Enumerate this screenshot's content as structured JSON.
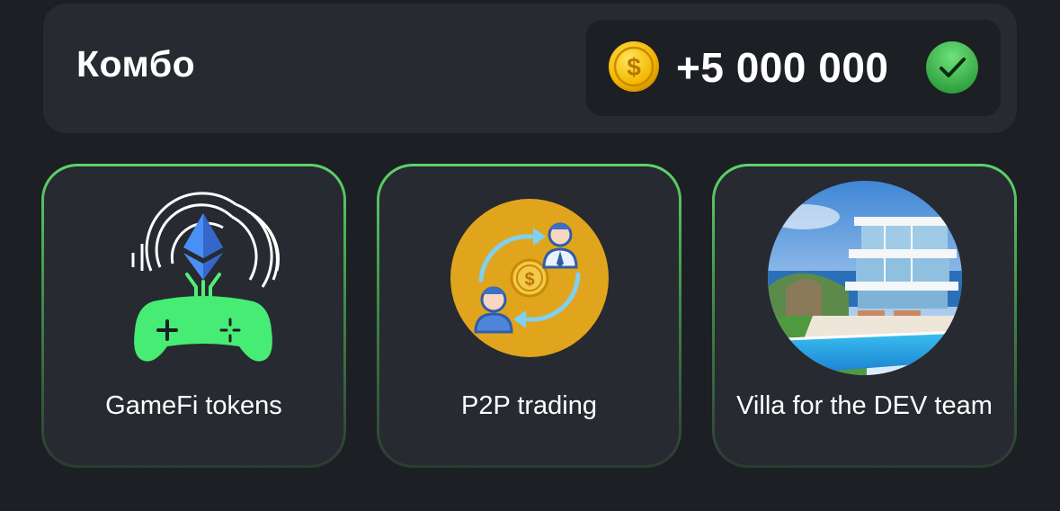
{
  "combo": {
    "title": "Комбо",
    "reward_amount": "+5 000 000",
    "coin_icon": "coin-icon",
    "check_icon": "check-icon",
    "accent_color": "#4fd35c"
  },
  "cards": [
    {
      "label": "GameFi tokens",
      "icon": "gamefi-ethereum-gamepad-icon",
      "completed": true
    },
    {
      "label": "P2P trading",
      "icon": "p2p-exchange-icon",
      "completed": true
    },
    {
      "label": "Villa for the DEV team",
      "icon": "villa-image",
      "completed": true
    }
  ]
}
